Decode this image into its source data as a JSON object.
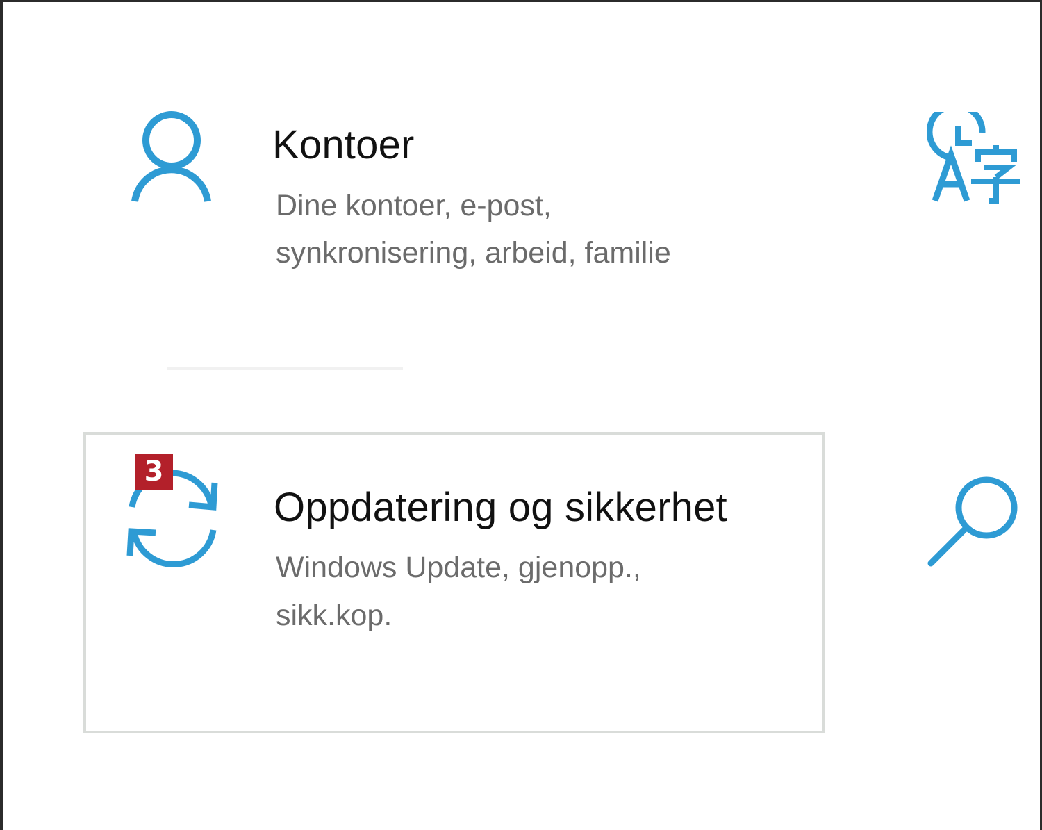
{
  "accent_color": "#2e9bd4",
  "badge_color": "#b3202a",
  "tiles": [
    {
      "icon": "person-icon",
      "title": "Kontoer",
      "desc_line1": "Dine kontoer, e-post,",
      "desc_line2": "synkronisering, arbeid, familie"
    },
    {
      "icon": "sync-arrows-icon",
      "title": "Oppdatering og sikkerhet",
      "desc_line1": "Windows Update, gjenopp.,",
      "desc_line2": "sikk.kop.",
      "badge": "3"
    }
  ],
  "side_icons": [
    "time-language-icon",
    "search-icon"
  ]
}
